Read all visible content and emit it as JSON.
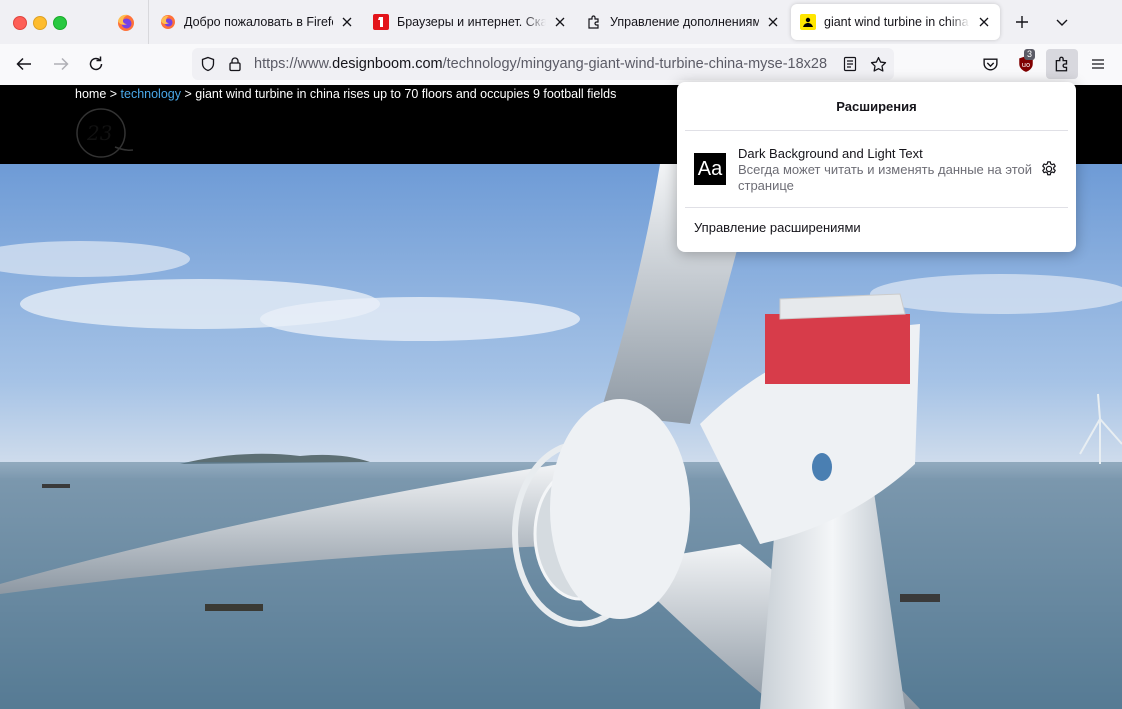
{
  "tabs": [
    {
      "title": "Добро пожаловать в Firefox",
      "favicon": "firefox-icon"
    },
    {
      "title": "Браузеры и интернет. Скача",
      "favicon": "site-red-icon"
    },
    {
      "title": "Управление дополнениями",
      "favicon": "puzzle-icon"
    },
    {
      "title": "giant wind turbine in china rise",
      "favicon": "designboom-icon",
      "active": true
    }
  ],
  "url": {
    "prefix": "https://www.",
    "host": "designboom.com",
    "path": "/technology/mingyang-giant-wind-turbine-china-myse-18x28"
  },
  "toolbar": {
    "ublock_badge": "3"
  },
  "page": {
    "breadcrumb": {
      "home": "home",
      "sep1": " > ",
      "category": "technology",
      "sep2": " > ",
      "title": "giant wind turbine in china rises up to 70 floors and occupies 9 football fields"
    },
    "logo_text": "23"
  },
  "extensions_panel": {
    "title": "Расширения",
    "item": {
      "icon_text": "Aa",
      "name": "Dark Background and Light Text",
      "description": "Всегда может читать и изменять данные на этой странице"
    },
    "manage_label": "Управление расширениями"
  },
  "colors": {
    "accent_link": "#4aa8e8",
    "close": "#fe5f57",
    "minimize": "#febc2e",
    "maximize": "#28c840",
    "ublock_red": "#800000"
  }
}
